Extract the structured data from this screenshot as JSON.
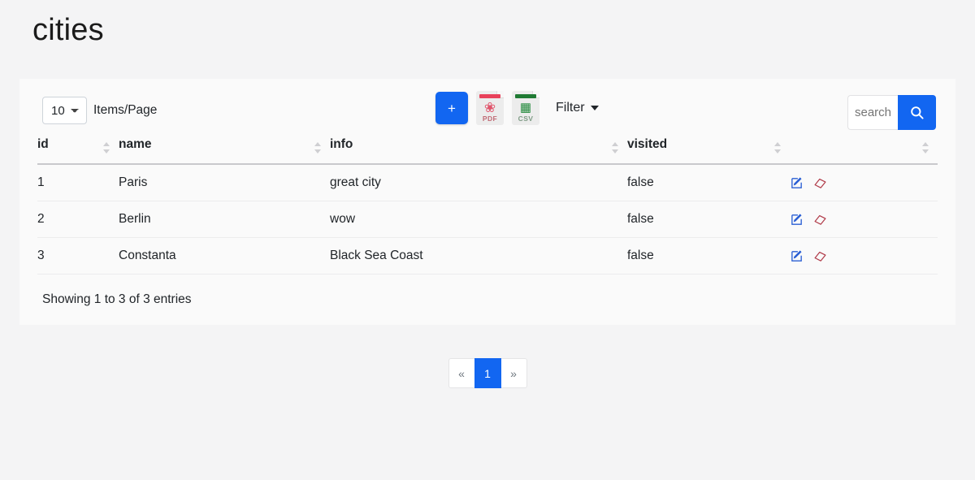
{
  "page": {
    "title": "cities",
    "accent_color": "#1266f1",
    "background_color": "#f4f4f5",
    "card_color": "#fafafa"
  },
  "toolbar": {
    "items_per_page_value": "10",
    "items_per_page_options": [
      "10"
    ],
    "items_per_page_label": "Items/Page",
    "add_label": "+",
    "pdf_label": "PDF",
    "pdf_color": "#e8415a",
    "csv_label": "CSV",
    "csv_color": "#1f7a33",
    "filter_label": "Filter",
    "search_placeholder": "search",
    "search_value": "",
    "search_button_icon": "search-icon"
  },
  "table": {
    "columns": [
      {
        "key": "id",
        "label": "id",
        "sortable": true
      },
      {
        "key": "name",
        "label": "name",
        "sortable": true
      },
      {
        "key": "info",
        "label": "info",
        "sortable": true
      },
      {
        "key": "visited",
        "label": "visited",
        "sortable": true
      },
      {
        "key": "actions",
        "label": "",
        "sortable": true
      }
    ],
    "rows": [
      {
        "id": "1",
        "name": "Paris",
        "info": "great city",
        "visited": "false"
      },
      {
        "id": "2",
        "name": "Berlin",
        "info": "wow",
        "visited": "false"
      },
      {
        "id": "3",
        "name": "Constanta",
        "info": "Black Sea Coast",
        "visited": "false"
      }
    ],
    "row_actions": [
      {
        "name": "edit-icon",
        "color": "#2a5fd4"
      },
      {
        "name": "delete-icon",
        "color": "#b03a48"
      }
    ]
  },
  "footer": {
    "entries_text": "Showing 1 to 3 of 3 entries"
  },
  "pagination": {
    "previous_label": "«",
    "next_label": "»",
    "pages": [
      "1"
    ],
    "active_page": "1"
  }
}
